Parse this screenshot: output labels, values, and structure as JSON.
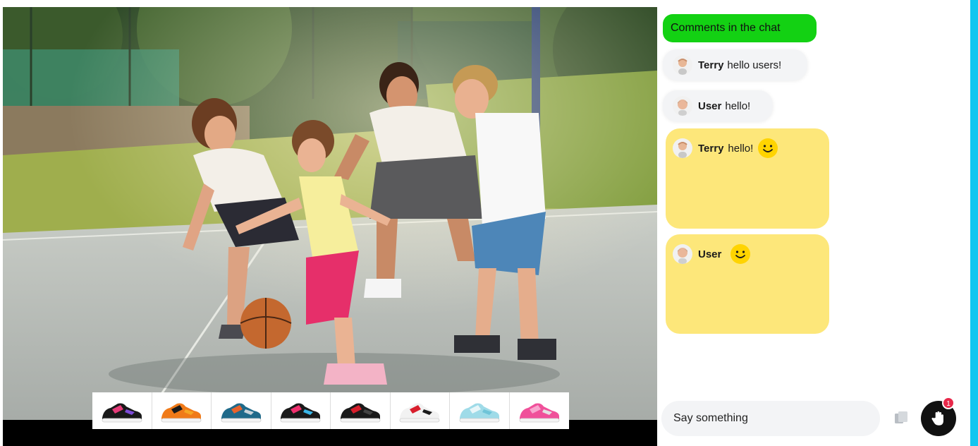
{
  "chat": {
    "title": "Comments in the chat",
    "messages": [
      {
        "user": "Terry",
        "text": "hello users!"
      },
      {
        "user": "User",
        "text": "hello!"
      }
    ],
    "emoji_cards": [
      {
        "user": "Terry",
        "text": "hello!",
        "emoji": "smiley-icon"
      },
      {
        "user": "User",
        "text": "",
        "emoji": "smiley-icon"
      }
    ],
    "input": {
      "placeholder": "Say something",
      "value": ""
    },
    "reaction_badge": "1"
  },
  "products": [
    {
      "name": "sneaker-1",
      "colors": [
        "#1a1a1a",
        "#e63b7a",
        "#7d4bd8"
      ]
    },
    {
      "name": "sneaker-2",
      "colors": [
        "#f07a18",
        "#1a1a1a",
        "#f5a623"
      ]
    },
    {
      "name": "sneaker-3",
      "colors": [
        "#1f6a8a",
        "#e8632c",
        "#c9d4da"
      ]
    },
    {
      "name": "sneaker-4",
      "colors": [
        "#1a1a1a",
        "#f0306e",
        "#3ab6e8"
      ]
    },
    {
      "name": "sneaker-5",
      "colors": [
        "#1a1a1a",
        "#d81e2c",
        "#444444"
      ]
    },
    {
      "name": "sneaker-6",
      "colors": [
        "#f2f2f2",
        "#d81e2c",
        "#1a1a1a"
      ]
    },
    {
      "name": "sneaker-7",
      "colors": [
        "#9fdbe8",
        "#e8f6f9",
        "#6fc4d8"
      ]
    },
    {
      "name": "sneaker-8",
      "colors": [
        "#f0509a",
        "#f8a6cf",
        "#e2e2e2"
      ]
    }
  ],
  "colors": {
    "chat_title_bg": "#13d113",
    "emoji_card_bg": "#fde77a",
    "accent": "#12c6f0",
    "badge": "#e8284a"
  }
}
